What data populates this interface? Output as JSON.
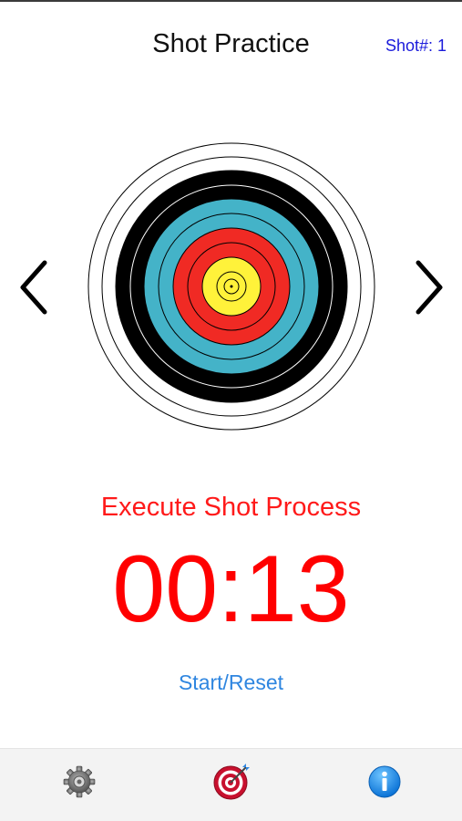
{
  "header": {
    "title": "Shot Practice",
    "shot_counter": "Shot#: 1"
  },
  "target": {
    "icon": "archery-target",
    "ring_colors": {
      "white": "#ffffff",
      "black": "#000000",
      "blue": "#44b3c8",
      "red": "#f02a24",
      "yellow": "#fff23a"
    }
  },
  "navigation": {
    "previous_icon": "chevron-left-icon",
    "next_icon": "chevron-right-icon"
  },
  "status": {
    "text": "Execute Shot Process"
  },
  "timer": {
    "value": "00:13"
  },
  "controls": {
    "start_reset_label": "Start/Reset"
  },
  "tab_bar": {
    "items": [
      {
        "icon": "gear-icon"
      },
      {
        "icon": "target-icon",
        "selected": true
      },
      {
        "icon": "info-icon"
      }
    ]
  },
  "colors": {
    "accent_red": "#ff0000",
    "link_blue": "#2f86e0",
    "counter_blue": "#1a1adb"
  }
}
